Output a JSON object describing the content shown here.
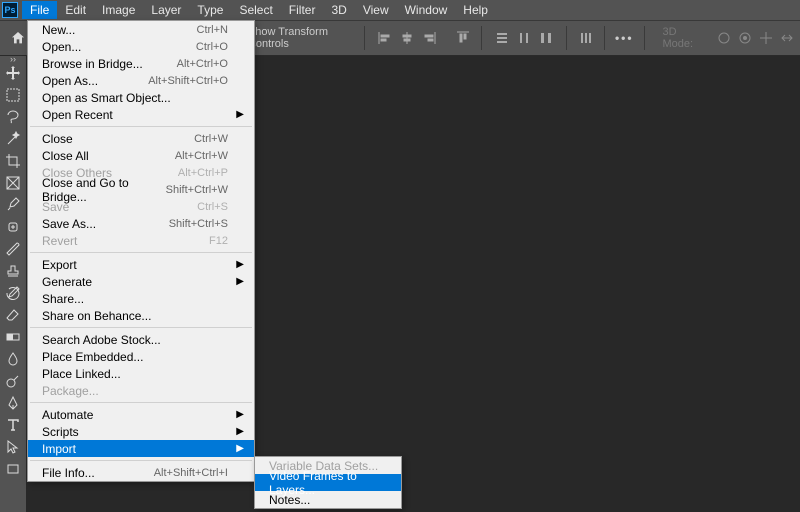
{
  "app": {
    "ps": "Ps"
  },
  "menubar": [
    "File",
    "Edit",
    "Image",
    "Layer",
    "Type",
    "Select",
    "Filter",
    "3D",
    "View",
    "Window",
    "Help"
  ],
  "toolbar": {
    "show_transform": "Show Transform Controls",
    "mode_3d": "3D Mode:"
  },
  "file_menu": {
    "groups": [
      [
        {
          "label": "New...",
          "shortcut": "Ctrl+N"
        },
        {
          "label": "Open...",
          "shortcut": "Ctrl+O"
        },
        {
          "label": "Browse in Bridge...",
          "shortcut": "Alt+Ctrl+O"
        },
        {
          "label": "Open As...",
          "shortcut": "Alt+Shift+Ctrl+O"
        },
        {
          "label": "Open as Smart Object..."
        },
        {
          "label": "Open Recent",
          "submenu": true
        }
      ],
      [
        {
          "label": "Close",
          "shortcut": "Ctrl+W"
        },
        {
          "label": "Close All",
          "shortcut": "Alt+Ctrl+W"
        },
        {
          "label": "Close Others",
          "shortcut": "Alt+Ctrl+P",
          "disabled": true
        },
        {
          "label": "Close and Go to Bridge...",
          "shortcut": "Shift+Ctrl+W"
        },
        {
          "label": "Save",
          "shortcut": "Ctrl+S",
          "disabled": true
        },
        {
          "label": "Save As...",
          "shortcut": "Shift+Ctrl+S"
        },
        {
          "label": "Revert",
          "shortcut": "F12",
          "disabled": true
        }
      ],
      [
        {
          "label": "Export",
          "submenu": true
        },
        {
          "label": "Generate",
          "submenu": true
        },
        {
          "label": "Share..."
        },
        {
          "label": "Share on Behance..."
        }
      ],
      [
        {
          "label": "Search Adobe Stock..."
        },
        {
          "label": "Place Embedded..."
        },
        {
          "label": "Place Linked..."
        },
        {
          "label": "Package...",
          "disabled": true
        }
      ],
      [
        {
          "label": "Automate",
          "submenu": true
        },
        {
          "label": "Scripts",
          "submenu": true
        },
        {
          "label": "Import",
          "submenu": true,
          "highlighted": true
        }
      ],
      [
        {
          "label": "File Info...",
          "shortcut": "Alt+Shift+Ctrl+I"
        }
      ]
    ]
  },
  "import_submenu": [
    {
      "label": "Variable Data Sets...",
      "disabled": true
    },
    {
      "label": "Video Frames to Layers...",
      "highlighted": true
    },
    {
      "label": "Notes..."
    }
  ]
}
